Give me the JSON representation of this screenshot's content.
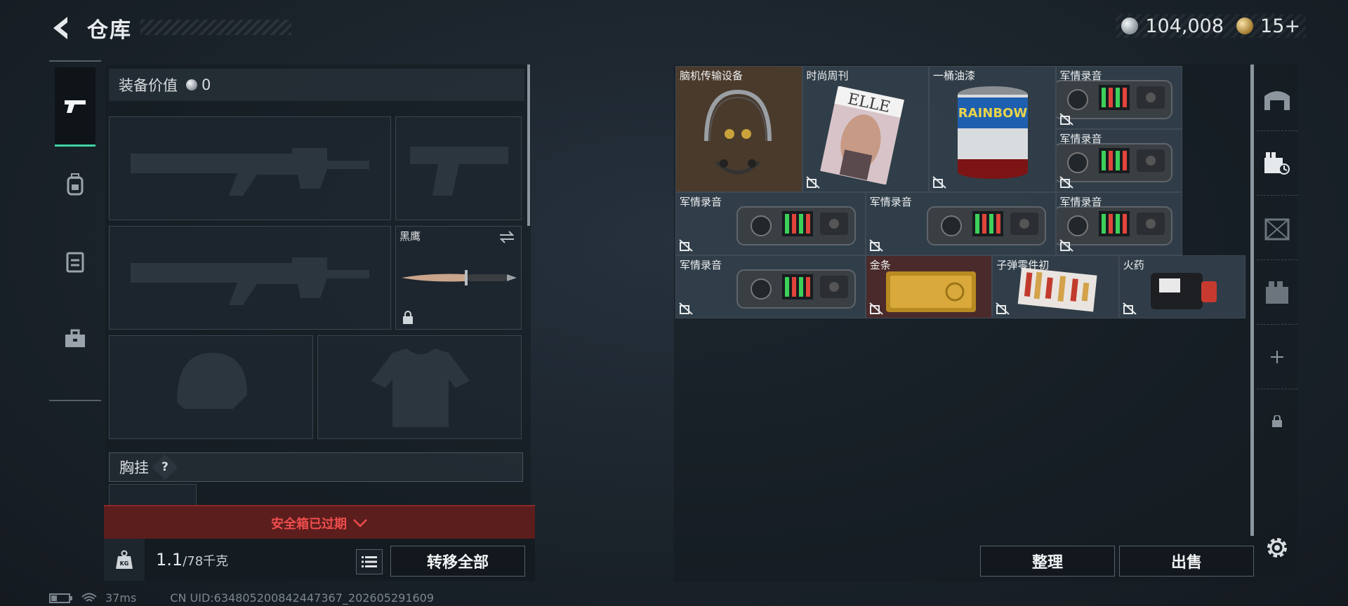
{
  "header": {
    "title": "仓库",
    "silver": "104,008",
    "gold": "15+"
  },
  "equipment": {
    "value_label": "装备价值",
    "value": "0",
    "melee_name": "黑鹰",
    "chest_label": "胸挂",
    "chest_help": "?",
    "safe_warning": "安全箱已过期",
    "weight_current": "1.1",
    "weight_max": "/78千克",
    "weight_unit_icon": "KG",
    "transfer_all": "转移全部"
  },
  "stash": {
    "items": [
      {
        "name": "脑机传输设备",
        "icon": "headset-icon"
      },
      {
        "name": "时尚周刊",
        "icon": "magazine-icon"
      },
      {
        "name": "一桶油漆",
        "icon": "paint-bucket-icon"
      },
      {
        "name": "军情录音",
        "icon": "recorder-icon"
      },
      {
        "name": "军情录音",
        "icon": "recorder-icon"
      },
      {
        "name": "军情录音",
        "icon": "recorder-icon"
      },
      {
        "name": "军情录音",
        "icon": "recorder-icon"
      },
      {
        "name": "军情录音",
        "icon": "recorder-icon"
      },
      {
        "name": "军情录音",
        "icon": "recorder-icon"
      },
      {
        "name": "金条",
        "icon": "gold-bar-icon"
      },
      {
        "name": "子弹零件初",
        "icon": "ammo-box-icon"
      },
      {
        "name": "火药",
        "icon": "gunpowder-icon"
      }
    ],
    "sort_label": "整理",
    "sell_label": "出售"
  },
  "status": {
    "ping": "37ms",
    "uid": "CN UID:634805200842447367_202605291609"
  },
  "colors": {
    "accent": "#3fd3a2",
    "warning": "#ef4d4d",
    "gold": "#c9a23a"
  }
}
